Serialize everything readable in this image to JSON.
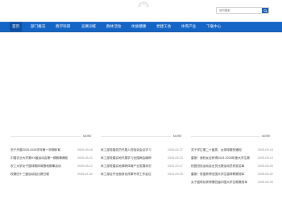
{
  "header": {
    "logo_icon": "arc-logo-icon"
  },
  "search": {
    "placeholder": "站内搜索",
    "button_icon": "search-icon"
  },
  "nav": {
    "items": [
      {
        "label": "首页"
      },
      {
        "label": "部门概况"
      },
      {
        "label": "教学科研"
      },
      {
        "label": "竞赛训练"
      },
      {
        "label": "群体活动"
      },
      {
        "label": "体质健康"
      },
      {
        "label": "党建工会"
      },
      {
        "label": "体育产业"
      },
      {
        "label": "下载中心"
      }
    ]
  },
  "sections": [
    {
      "more": "MORE",
      "rows": [
        {
          "title": "关于开展2025-2026学年第一学期体育",
          "date": "2025-09-16"
        },
        {
          "title": "中国农业大学第XX届运动会第一期赛事通知",
          "date": "2025-06-23"
        },
        {
          "title": "农工大学女子篮球赛体育基地赛事活动",
          "date": "2025-06-12"
        },
        {
          "title": "校第四十三届运动会比赛日程",
          "date": "2025-04-30"
        }
      ]
    },
    {
      "more": "MORE",
      "rows": [
        {
          "title": "体工部党建党员开展入党培训会议学习",
          "date": "2025-05-27"
        },
        {
          "title": "体工部党建实地开展学习全国两会精神",
          "date": "2025-05-23"
        },
        {
          "title": "体工部党建实地调研体育产业发展状况",
          "date": "2024-10-17"
        },
        {
          "title": "体工部召开全面深化改革专项工作会议",
          "date": "2024-09-20"
        }
      ]
    },
    {
      "more": "MORE",
      "rows": [
        {
          "title": "关于学生第二十届男、女排球赛的通知",
          "date": "2025-09-16"
        },
        {
          "title": "喜报！我校女足获得2024-2025年度大学生赛",
          "date": "2025-08-13"
        },
        {
          "title": "校园田径运动会全员比赛运动员获奖名单",
          "date": "2025-06-03"
        },
        {
          "title": "喜报！男篮获得全国大学生篮球联赛冠军",
          "date": "2025-06-02"
        },
        {
          "title": "女子篮球队获得第四届中国大学生联赛冠军",
          "date": "2025-06-09"
        }
      ]
    }
  ],
  "colors": {
    "nav_bg": "#1565c7",
    "nav_active": "#0c4fa3",
    "accent": "#1557b0"
  }
}
